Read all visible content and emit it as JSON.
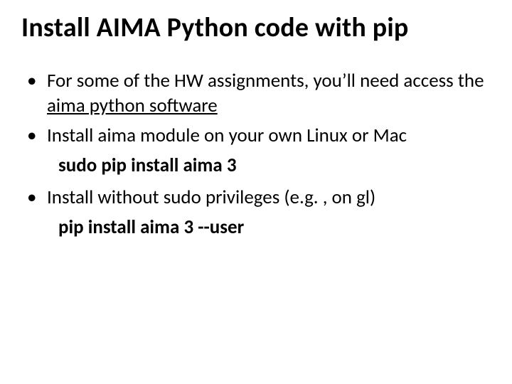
{
  "title": "Install AIMA Python code with pip",
  "bullets": {
    "b1_pre": "For some of the HW assignments, you’ll need access the ",
    "b1_link": "aima python software",
    "b2": "Install aima module on your own Linux or Mac",
    "cmd1": "sudo pip install aima 3",
    "b3": "Install without sudo privileges (e.g. , on gl)",
    "cmd2": "pip install aima 3 --user"
  }
}
